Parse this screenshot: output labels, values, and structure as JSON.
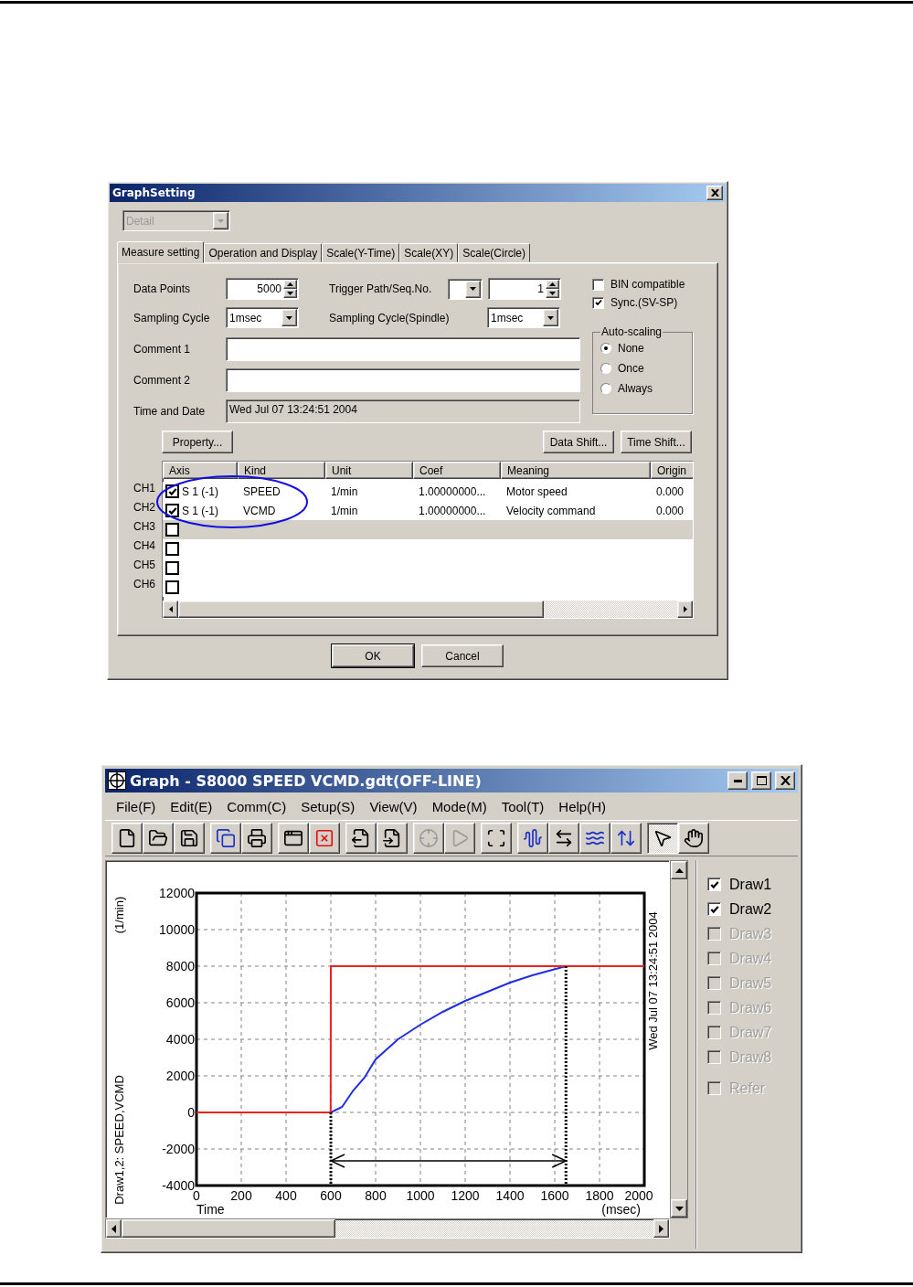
{
  "dialog": {
    "title": "GraphSetting",
    "view_select": {
      "value": "Detail",
      "disabled": true
    },
    "tabs": [
      {
        "label": "Measure setting",
        "selected": true
      },
      {
        "label": "Operation and Display",
        "selected": false
      },
      {
        "label": "Scale(Y-Time)",
        "selected": false
      },
      {
        "label": "Scale(XY)",
        "selected": false
      },
      {
        "label": "Scale(Circle)",
        "selected": false
      }
    ],
    "data_points": {
      "label": "Data Points",
      "value": "5000"
    },
    "trigger": {
      "label": "Trigger Path/Seq.No.",
      "value": "1"
    },
    "sampling_cycle": {
      "label": "Sampling Cycle",
      "value": "1msec"
    },
    "sampling_cycle_spindle": {
      "label": "Sampling Cycle(Spindle)",
      "value": "1msec"
    },
    "comment_1": {
      "label": "Comment 1"
    },
    "comment_2": {
      "label": "Comment 2"
    },
    "time_and_date": {
      "label": "Time and Date",
      "value": "Wed Jul 07 13:24:51 2004"
    },
    "options": [
      {
        "label": "BIN compatible",
        "checked": false
      },
      {
        "label": "Sync.(SV-SP)",
        "checked": true
      }
    ],
    "auto_scaling": {
      "title": "Auto-scaling",
      "options": [
        {
          "label": "None",
          "selected": true
        },
        {
          "label": "Once",
          "selected": false
        },
        {
          "label": "Always",
          "selected": false
        }
      ]
    },
    "property_button": "Property...",
    "shift_buttons": [
      "Data Shift...",
      "Time Shift..."
    ],
    "channel_table": {
      "columns": [
        "Axis",
        "Kind",
        "Unit",
        "Coef",
        "Meaning",
        "Origin"
      ],
      "rows": [
        {
          "channel": "CH1",
          "checked": true,
          "selected": false,
          "cells": [
            "S 1 (-1)",
            "SPEED",
            "1/min",
            "1.00000000...",
            "Motor speed",
            "0.000"
          ]
        },
        {
          "channel": "CH2",
          "checked": true,
          "selected": false,
          "cells": [
            "S 1 (-1)",
            "VCMD",
            "1/min",
            "1.00000000...",
            "Velocity command",
            "0.000"
          ]
        },
        {
          "channel": "CH3",
          "checked": false,
          "selected": true,
          "cells": []
        },
        {
          "channel": "CH4",
          "checked": false,
          "selected": false,
          "cells": []
        },
        {
          "channel": "CH5",
          "checked": false,
          "selected": false,
          "cells": []
        },
        {
          "channel": "CH6",
          "checked": false,
          "selected": false,
          "cells": []
        }
      ]
    },
    "buttons": [
      "OK",
      "Cancel"
    ]
  },
  "graph_window": {
    "title": "Graph - S8000 SPEED VCMD.gdt(OFF-LINE)",
    "menu": [
      "File(F)",
      "Edit(E)",
      "Comm(C)",
      "Setup(S)",
      "View(V)",
      "Mode(M)",
      "Tool(T)",
      "Help(H)"
    ],
    "toolbar": [
      [
        {
          "disabled": false,
          "pressed": false
        },
        {
          "disabled": false,
          "pressed": false
        },
        {
          "disabled": false,
          "pressed": false
        }
      ],
      [
        {
          "disabled": false,
          "pressed": false
        },
        {
          "disabled": false,
          "pressed": false
        }
      ],
      [
        {
          "disabled": false,
          "pressed": false
        },
        {
          "disabled": false,
          "pressed": false
        }
      ],
      [
        {
          "disabled": false,
          "pressed": false
        },
        {
          "disabled": false,
          "pressed": false
        }
      ],
      [
        {
          "disabled": true,
          "pressed": false
        },
        {
          "disabled": true,
          "pressed": false
        }
      ],
      [
        {
          "disabled": false,
          "pressed": false
        }
      ],
      [
        {
          "disabled": false,
          "pressed": false
        },
        {
          "disabled": false,
          "pressed": false
        },
        {
          "disabled": false,
          "pressed": false
        },
        {
          "disabled": false,
          "pressed": false
        }
      ],
      [
        {
          "disabled": false,
          "pressed": true
        },
        {
          "disabled": false,
          "pressed": false
        }
      ]
    ],
    "y_unit": "(1/min)",
    "x_unit": "(msec)",
    "timestamp": "Wed Jul 07 13:24:51 2004",
    "chart_data": {
      "type": "line",
      "xlabel": "Time",
      "ylabel": "Draw1,2: SPEED,VCMD",
      "x": [
        0,
        599,
        600,
        650,
        700,
        750,
        800,
        900,
        1000,
        1100,
        1200,
        1300,
        1400,
        1500,
        1650,
        2000
      ],
      "series": [
        {
          "color": "#1f2ee6",
          "values": [
            0,
            0,
            0,
            300,
            1200,
            1900,
            2900,
            4000,
            4800,
            5500,
            6100,
            6600,
            7100,
            7500,
            8000,
            null
          ]
        },
        {
          "color": "#ee2020",
          "values": [
            0,
            0,
            8000,
            8000,
            8000,
            8000,
            8000,
            8000,
            8000,
            8000,
            8000,
            8000,
            8000,
            8000,
            8000,
            8000
          ]
        }
      ],
      "xlim": [
        0,
        2000
      ],
      "ylim": [
        -4000,
        12000
      ],
      "xticks": [
        0,
        200,
        400,
        600,
        800,
        1000,
        1200,
        1400,
        1600,
        1800,
        2000
      ],
      "yticks": [
        -4000,
        -2000,
        0,
        2000,
        4000,
        6000,
        8000,
        10000,
        12000
      ],
      "grid": true,
      "ref_lines": [
        {
          "axis": "x",
          "value": 600
        },
        {
          "axis": "x",
          "value": 1650
        }
      ]
    },
    "draws": [
      {
        "label": "Draw1",
        "checked": true,
        "disabled": false
      },
      {
        "label": "Draw2",
        "checked": true,
        "disabled": false
      },
      {
        "label": "Draw3",
        "checked": false,
        "disabled": true
      },
      {
        "label": "Draw4",
        "checked": false,
        "disabled": true
      },
      {
        "label": "Draw5",
        "checked": false,
        "disabled": true
      },
      {
        "label": "Draw6",
        "checked": false,
        "disabled": true
      },
      {
        "label": "Draw7",
        "checked": false,
        "disabled": true
      },
      {
        "label": "Draw8",
        "checked": false,
        "disabled": true
      }
    ],
    "refer": {
      "label": "Refer",
      "checked": false,
      "disabled": true
    }
  }
}
